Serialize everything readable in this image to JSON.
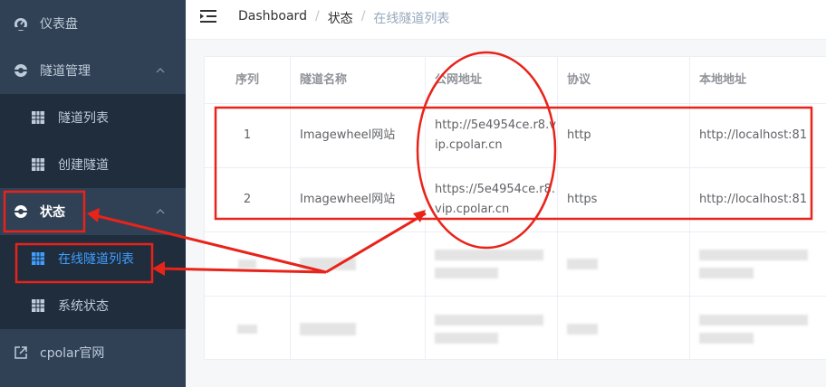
{
  "sidebar": {
    "items": [
      {
        "label": "仪表盘",
        "icon": "dashboard-icon"
      },
      {
        "label": "隧道管理",
        "icon": "tunnel-manage-icon"
      },
      {
        "label": "隧道列表",
        "icon": "grid-icon"
      },
      {
        "label": "创建隧道",
        "icon": "grid-icon"
      },
      {
        "label": "状态",
        "icon": "status-icon"
      },
      {
        "label": "在线隧道列表",
        "icon": "grid-icon"
      },
      {
        "label": "系统状态",
        "icon": "grid-icon"
      },
      {
        "label": "cpolar官网",
        "icon": "external-link-icon"
      }
    ]
  },
  "breadcrumb": {
    "items": [
      "Dashboard",
      "状态",
      "在线隧道列表"
    ],
    "separator": "/"
  },
  "table": {
    "columns": [
      "序列",
      "隧道名称",
      "公网地址",
      "协议",
      "本地地址"
    ],
    "rows": [
      {
        "index": "1",
        "name": "Imagewheel网站",
        "url_line1": "http://5e4954ce.r8.v",
        "url_line2": "ip.cpolar.cn",
        "protocol": "http",
        "local": "http://localhost:81"
      },
      {
        "index": "2",
        "name": "Imagewheel网站",
        "url_line1": "https://5e4954ce.r8.",
        "url_line2": "vip.cpolar.cn",
        "protocol": "https",
        "local": "http://localhost:81"
      }
    ]
  },
  "colors": {
    "sidebar_bg": "#304156",
    "submenu_bg": "#1f2d3d",
    "active_blue": "#409eff",
    "annotation_red": "#e8231a"
  }
}
